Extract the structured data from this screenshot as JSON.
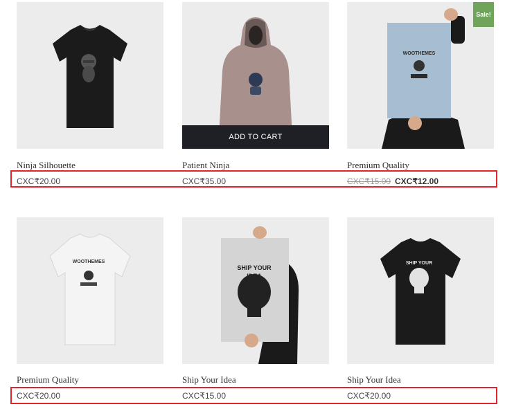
{
  "products": [
    {
      "title": "Ninja Silhouette",
      "price": "CXC₹20.00",
      "image": "black-tshirt-ninja-silhouette"
    },
    {
      "title": "Patient Ninja",
      "price": "CXC₹35.00",
      "image": "grey-hoodie-ninja",
      "button": "ADD TO CART"
    },
    {
      "title": "Premium Quality",
      "old_price": "CXC₹15.00",
      "sale_price": "CXC₹12.00",
      "badge": "Sale!",
      "image": "woothemes-poster"
    },
    {
      "title": "Premium Quality",
      "price": "CXC₹20.00",
      "image": "white-tshirt-woothemes"
    },
    {
      "title": "Ship Your Idea",
      "price": "CXC₹15.00",
      "image": "ship-your-idea-poster"
    },
    {
      "title": "Ship Your Idea",
      "price": "CXC₹20.00",
      "image": "black-tshirt-ship-your-idea"
    }
  ],
  "poster_text": {
    "woothemes": "WOOTHEMES",
    "ship_your": "SHIP YOUR",
    "idea": "IDEA"
  },
  "colors": {
    "thumb_bg": "#ececec",
    "button_bg": "#1f2025",
    "sale_badge": "#6fa45a",
    "highlight": "#e3232b"
  }
}
